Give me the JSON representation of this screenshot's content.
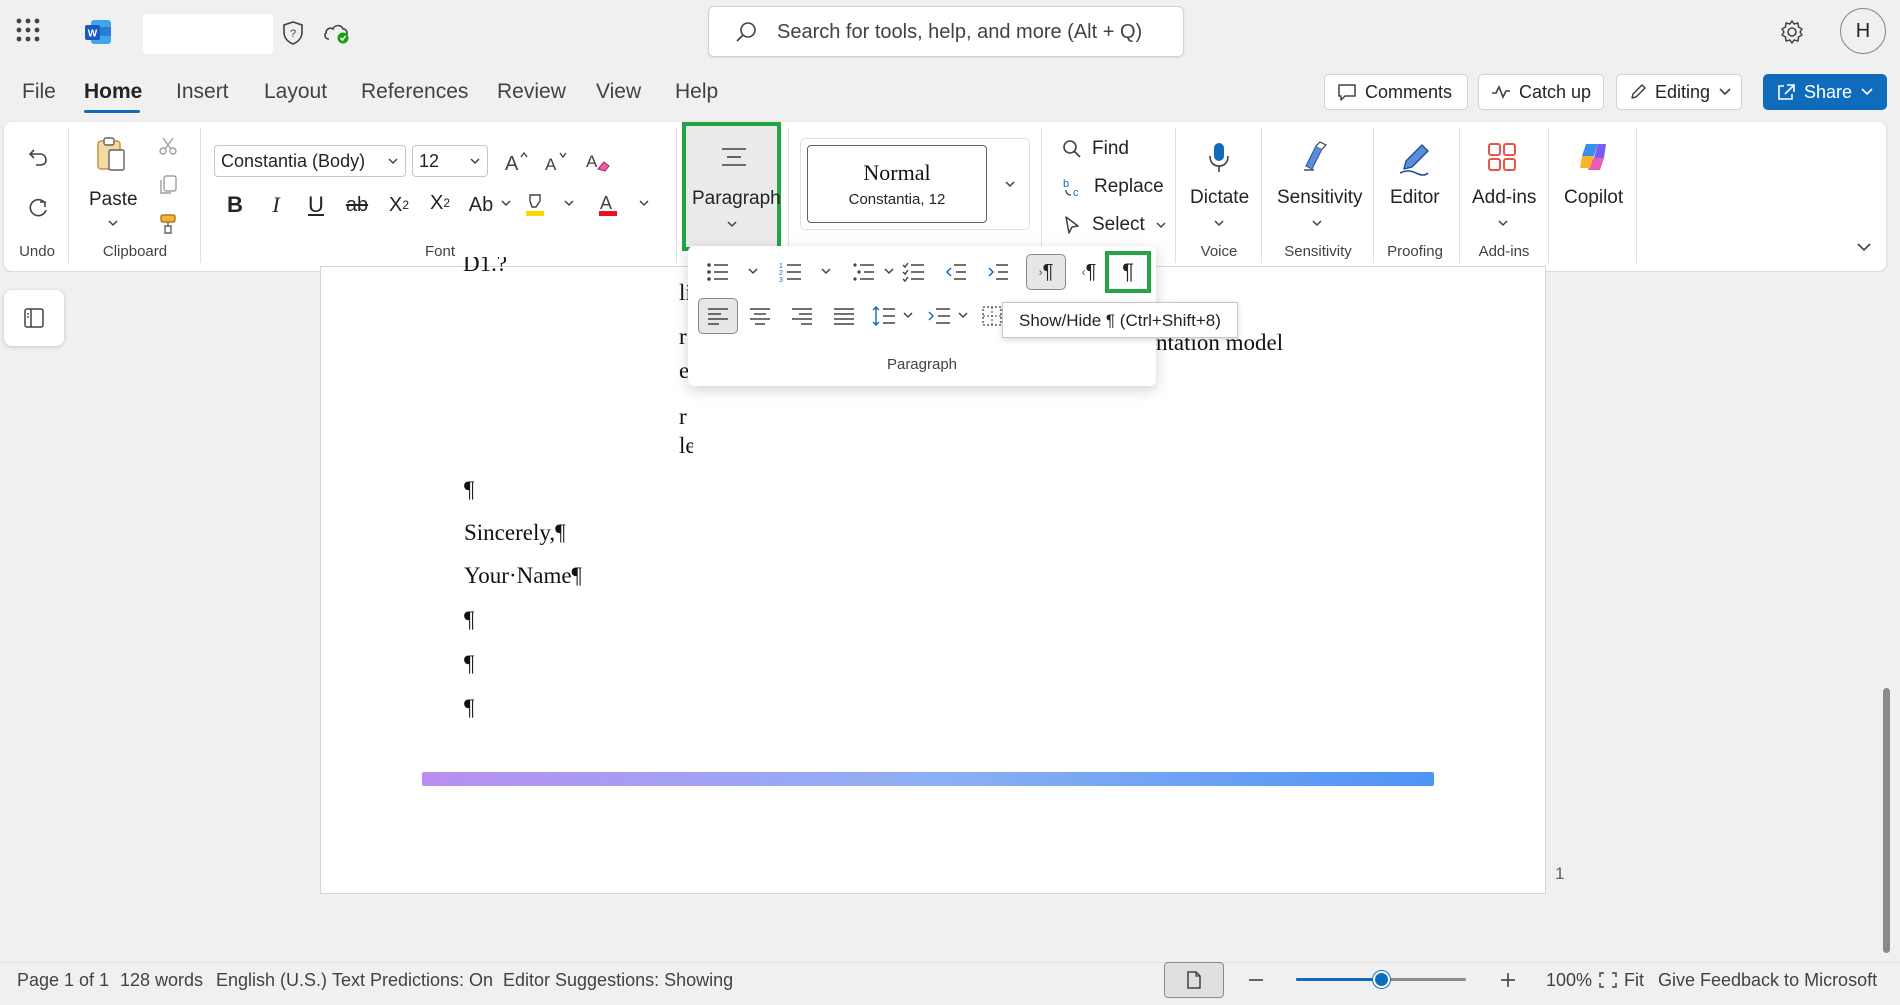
{
  "titlebar": {
    "search_placeholder": "Search for tools, help, and more (Alt + Q)",
    "avatar_initial": "H"
  },
  "tabs": [
    "File",
    "Home",
    "Insert",
    "Layout",
    "References",
    "Review",
    "View",
    "Help"
  ],
  "top_buttons": {
    "comments": "Comments",
    "catchup": "Catch up",
    "editing": "Editing",
    "share": "Share"
  },
  "ribbon": {
    "undo_label": "Undo",
    "paste_label": "Paste",
    "clipboard_label": "Clipboard",
    "font_name": "Constantia (Body)",
    "font_size": "12",
    "font_label": "Font",
    "paragraph_button": "Paragraph",
    "style_name": "Normal",
    "style_sub": "Constantia, 12",
    "find": "Find",
    "replace": "Replace",
    "select": "Select",
    "dictate": "Dictate",
    "voice_label": "Voice",
    "sensitivity": "Sensitivity",
    "sensitivity_label": "Sensitivity",
    "editor": "Editor",
    "proofing_label": "Proofing",
    "addins": "Add-ins",
    "addins_label": "Add-ins",
    "copilot": "Copilot"
  },
  "flyout": {
    "label": "Paragraph",
    "tooltip": "Show/Hide ¶ (Ctrl+Shift+8)"
  },
  "document": {
    "lines": [
      "¶",
      "Sincerely,¶",
      "Your·Name¶",
      "¶",
      "¶",
      "¶"
    ],
    "page_number": "1"
  },
  "status": {
    "page": "Page 1 of 1",
    "words": "128 words",
    "language": "English (U.S.)",
    "predictions": "Text Predictions: On",
    "editor": "Editor Suggestions: Showing",
    "zoom": "100%",
    "fit": "Fit",
    "feedback": "Give Feedback to Microsoft",
    "zoom_level": 0.5
  },
  "colors": {
    "accent": "#0f6cbd",
    "highlight": "#22a447",
    "font_color_bar": "#e81123",
    "highlighter_bar": "#ffd400"
  }
}
